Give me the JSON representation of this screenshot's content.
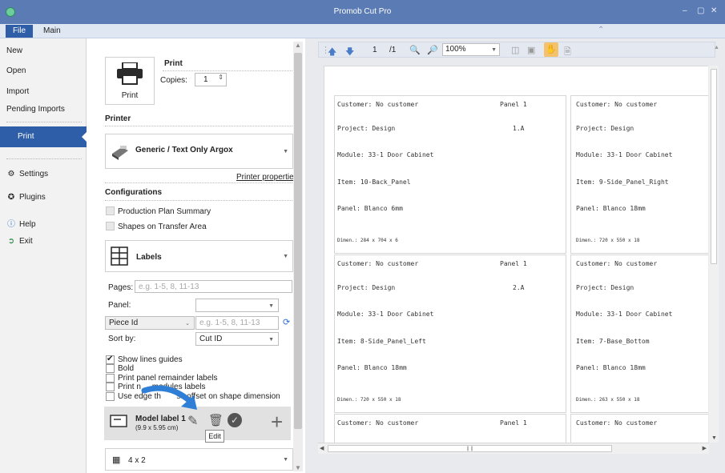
{
  "window": {
    "title": "Promob Cut Pro",
    "controls": [
      "–",
      "▢",
      "✕"
    ]
  },
  "menubar": {
    "file": "File",
    "main": "Main"
  },
  "left_menu": {
    "new": "New",
    "open": "Open",
    "import": "Import",
    "pending": "Pending Imports",
    "print": "Print",
    "settings": "Settings",
    "plugins": "Plugins",
    "help": "Help",
    "exit": "Exit"
  },
  "print_section": {
    "heading": "Print",
    "copies_label": "Copies:",
    "copies_value": "1",
    "button_label": "Print"
  },
  "printer": {
    "heading": "Printer",
    "name": "Generic / Text Only Argox",
    "properties_link": "Printer properties"
  },
  "configurations": {
    "heading": "Configurations",
    "options": [
      "Production Plan Summary",
      "Shapes on Transfer Area"
    ],
    "label_type": "Labels"
  },
  "filters": {
    "pages_label": "Pages:",
    "pages_placeholder": "e.g. 1-5, 8, 11-13",
    "panel_label": "Panel:",
    "piece_select": "Piece Id",
    "piece_placeholder": "e.g. 1-5, 8, 11-13",
    "sort_label": "Sort by:",
    "sort_value": "Cut ID"
  },
  "checks": [
    {
      "label": "Show lines guides",
      "checked": true
    },
    {
      "label": "Bold",
      "checked": false
    },
    {
      "label": "Print panel remainder labels",
      "checked": false
    },
    {
      "label": "Print n     modules labels",
      "checked": false
    },
    {
      "label": "Use edge th       ss offset on shape dimension",
      "checked": false
    }
  ],
  "model": {
    "name": "Model label 1",
    "size": "(9.9 x 5.95 cm)",
    "tooltip": "Edit"
  },
  "grid_select": "4 x 2",
  "toolbar": {
    "page": "1",
    "total": "/1",
    "zoom": "100%"
  },
  "labels": [
    {
      "customer": "Customer: No customer",
      "panel": "Panel 1",
      "project": "Project: Design",
      "index": "1.A",
      "module": "Module: 33-1 Door Cabinet",
      "item": "Item: 10-Back_Panel",
      "material": "Panel: Blanco 6mm",
      "dimen": "Dimen.: 284 x 704 x 6"
    },
    {
      "customer": "Customer: No customer",
      "panel": "",
      "project": "Project: Design",
      "index": "",
      "module": "Module: 33-1 Door Cabinet",
      "item": "Item: 9-Side_Panel_Right",
      "material": "Panel: Blanco 18mm",
      "dimen": "Dimen.: 720 x 550 x 18"
    },
    {
      "customer": "Customer: No customer",
      "panel": "Panel 1",
      "project": "Project: Design",
      "index": "2.A",
      "module": "Module: 33-1 Door Cabinet",
      "item": "Item: 8-Side_Panel_Left",
      "material": "Panel: Blanco 18mm",
      "dimen": "Dimen.: 720 x 550 x 18"
    },
    {
      "customer": "Customer: No customer",
      "panel": "",
      "project": "Project: Design",
      "index": "",
      "module": "Module: 33-1 Door Cabinet",
      "item": "Item: 7-Base_Bottom",
      "material": "Panel: Blanco 18mm",
      "dimen": "Dimen.: 263 x 550 x 18"
    },
    {
      "customer": "Customer: No customer",
      "panel": "Panel 1"
    },
    {
      "customer": "Customer: No customer",
      "panel": ""
    }
  ]
}
